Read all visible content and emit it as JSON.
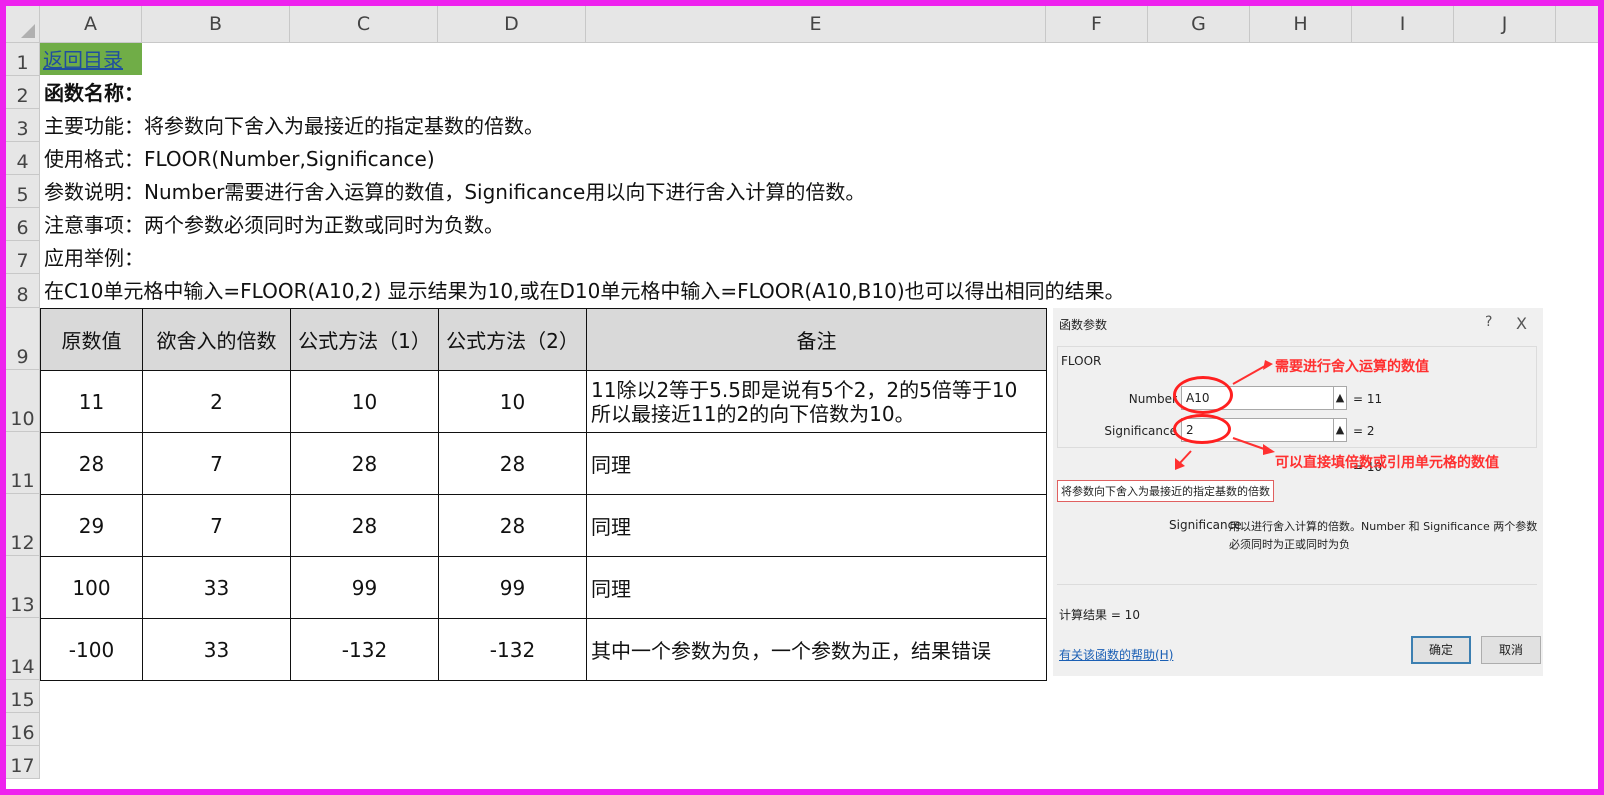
{
  "columns": [
    "A",
    "B",
    "C",
    "D",
    "E",
    "F",
    "G",
    "H",
    "I",
    "J"
  ],
  "rows": [
    "1",
    "2",
    "3",
    "4",
    "5",
    "6",
    "7",
    "8",
    "9",
    "10",
    "11",
    "12",
    "13",
    "14",
    "15",
    "16",
    "17"
  ],
  "link_text": "返回目录",
  "lines": {
    "r2": "函数名称：",
    "r3": "主要功能：将参数向下舍入为最接近的指定基数的倍数。",
    "r4": "使用格式：FLOOR(Number,Significance)",
    "r5": "参数说明：Number需要进行舍入运算的数值，Significance用以向下进行舍入计算的倍数。",
    "r6": "注意事项：两个参数必须同时为正数或同时为负数。",
    "r7": "应用举例：",
    "r8": "在C10单元格中输入=FLOOR(A10,2) 显示结果为10,或在D10单元格中输入=FLOOR(A10,B10)也可以得出相同的结果。"
  },
  "table": {
    "headers": [
      "原数值",
      "欲舍入的倍数",
      "公式方法（1）",
      "公式方法（2）",
      "备注"
    ],
    "rows": [
      [
        "11",
        "2",
        "10",
        "10",
        "11除以2等于5.5即是说有5个2，2的5倍等于10",
        "所以最接近11的2的向下倍数为10。"
      ],
      [
        "28",
        "7",
        "28",
        "28",
        "同理",
        ""
      ],
      [
        "29",
        "7",
        "28",
        "28",
        "同理",
        ""
      ],
      [
        "100",
        "33",
        "99",
        "99",
        "同理",
        ""
      ],
      [
        "-100",
        "33",
        "-132",
        "-132",
        "其中一个参数为负，一个参数为正，结果错误",
        ""
      ]
    ]
  },
  "dialog": {
    "title": "函数参数",
    "help_q": "?",
    "close": "X",
    "func_name": "FLOOR",
    "arg1_label": "Number",
    "arg1_value": "A10",
    "arg1_result": "=  11",
    "arg2_label": "Significance",
    "arg2_value": "2",
    "arg2_result": "=  2",
    "func_result_fragment": "= 10",
    "description": "将参数向下舍入为最接近的指定基数的倍数",
    "sig_name": "Significance",
    "sig_desc": "用以进行舍入计算的倍数。Number 和 Significance 两个参数必须同时为正或同时为负",
    "calc_result": "计算结果 =   10",
    "help_link": "有关该函数的帮助(H)",
    "ok": "确定",
    "cancel": "取消",
    "annotation1": "需要进行舍入运算的数值",
    "annotation2": "可以直接填倍数或引用单元格的数值",
    "accent_color": "#ff3030"
  },
  "frame_color": "#ee22ee"
}
